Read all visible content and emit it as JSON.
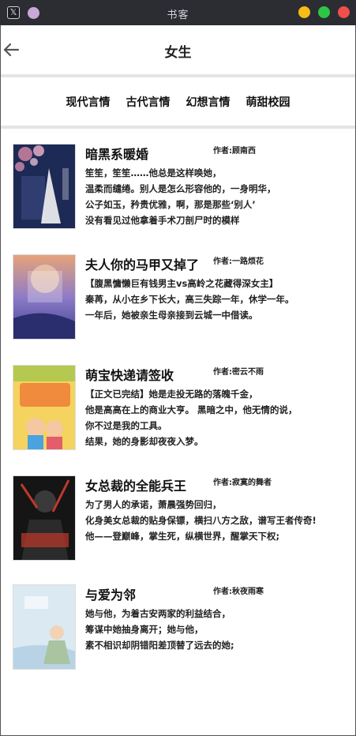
{
  "window": {
    "title": "书客",
    "x_icon": "x-icon"
  },
  "header": {
    "title": "女生",
    "back_icon": "arrow-left-icon"
  },
  "tabs": [
    "现代言情",
    "古代言情",
    "幻想言情",
    "萌甜校园"
  ],
  "books": [
    {
      "title": "暗黑系暖婚",
      "author": "作者:顾南西",
      "desc": [
        "笙笙，笙笙……他总是这样唤她，",
        "温柔而缱绻。别人是怎么形容他的，一身明华，",
        "公子如玉，矜贵优雅，啊，那是那些‘别人’",
        "没有看见过他拿着手术刀剖尸时的模样"
      ],
      "cover_colors": [
        "#1d2a55",
        "#d98aa8"
      ]
    },
    {
      "title": "夫人你的马甲又掉了",
      "author": "作者:一路烦花",
      "desc": [
        "【腹黑慵懒巨有钱男主vs高岭之花藏得深女主】",
        "秦苒，从小在乡下长大，高三失踪一年，休学一年。",
        "一年后，她被亲生母亲接到云城一中借读。"
      ],
      "cover_colors": [
        "#3a3f8e",
        "#e6a37a"
      ]
    },
    {
      "title": "萌宝快递请签收",
      "author": "作者:密云不雨",
      "desc": [
        "【正文已完结】她是走投无路的落魄千金，",
        "他是高高在上的商业大亨。 黑暗之中，他无情的说，",
        "你不过是我的工具。",
        "结果，她的身影却夜夜入梦。"
      ],
      "cover_colors": [
        "#f4d35e",
        "#f08a3c"
      ]
    },
    {
      "title": "女总裁的全能兵王",
      "author": "作者:寂寞的舞者",
      "desc": [
        "为了男人的承诺，萧晨强势回归，",
        "化身美女总裁的贴身保镖，横扫八方之敌，谱写王者传奇!",
        "他——登巅峰，掌生死，纵横世界，醒掌天下权;"
      ],
      "cover_colors": [
        "#151515",
        "#c0392b"
      ]
    },
    {
      "title": "与爱为邻",
      "author": "作者:秋夜雨寒",
      "desc": [
        "她与他，为着古安两家的利益结合，",
        "筹谋中她抽身离开；她与他，",
        "素不相识却阴错阳差顶替了远去的她;"
      ],
      "cover_colors": [
        "#dbe9f2",
        "#a9c4a0"
      ]
    }
  ]
}
